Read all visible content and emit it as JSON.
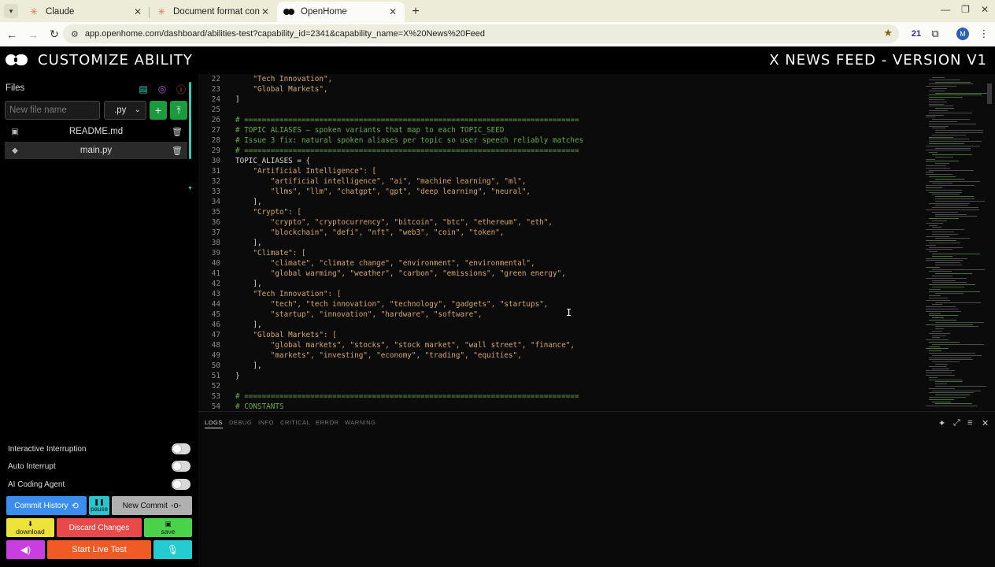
{
  "browser": {
    "tabs": [
      {
        "title": "Claude",
        "favicon": "claude-icon"
      },
      {
        "title": "Document format conve",
        "favicon": "claude-icon"
      },
      {
        "title": "OpenHome",
        "favicon": "openhome-icon"
      }
    ],
    "url": "app.openhome.com/dashboard/abilities-test?capability_id=2341&capability_name=X%20News%20Feed",
    "extension_badge": "21",
    "avatar_letter": "M"
  },
  "header": {
    "app_title": "CUSTOMIZE ABILITY",
    "ability_title": "X NEWS FEED - VERSION V1"
  },
  "sidebar": {
    "files_label": "Files",
    "filename_placeholder": "New file name",
    "extension_value": ".py",
    "files": [
      {
        "name": "README.md",
        "icon": "file-icon",
        "selected": false
      },
      {
        "name": "main.py",
        "icon": "python-icon",
        "selected": true
      }
    ],
    "toggles": [
      {
        "label": "Interactive Interruption",
        "on": false
      },
      {
        "label": "Auto Interrupt",
        "on": false
      },
      {
        "label": "AI Coding Agent",
        "on": false
      }
    ],
    "buttons": {
      "commit_history": "Commit History",
      "pause": "pause",
      "new_commit": "New Commit",
      "download": "download",
      "discard": "Discard Changes",
      "save": "save",
      "live_test": "Start Live Test"
    }
  },
  "editor": {
    "lines": [
      {
        "n": "22",
        "text": "    \"Tech Innovation\",",
        "kind": "str"
      },
      {
        "n": "23",
        "text": "    \"Global Markets\",",
        "kind": "str"
      },
      {
        "n": "24",
        "text": "]",
        "kind": "code"
      },
      {
        "n": "25",
        "text": "",
        "kind": "code"
      },
      {
        "n": "26",
        "text": "# ============================================================================",
        "kind": "comment"
      },
      {
        "n": "27",
        "text": "# TOPIC ALIASES — spoken variants that map to each TOPIC_SEED",
        "kind": "comment"
      },
      {
        "n": "28",
        "text": "# Issue 3 fix: natural spoken aliases per topic so user speech reliably matches",
        "kind": "comment"
      },
      {
        "n": "29",
        "text": "# ============================================================================",
        "kind": "comment"
      },
      {
        "n": "30",
        "text": "TOPIC_ALIASES = {",
        "kind": "code"
      },
      {
        "n": "31",
        "text": "    \"Artificial Intelligence\": [",
        "kind": "str"
      },
      {
        "n": "32",
        "text": "        \"artificial intelligence\", \"ai\", \"machine learning\", \"ml\",",
        "kind": "str"
      },
      {
        "n": "33",
        "text": "        \"llms\", \"llm\", \"chatgpt\", \"gpt\", \"deep learning\", \"neural\",",
        "kind": "str"
      },
      {
        "n": "34",
        "text": "    ],",
        "kind": "code"
      },
      {
        "n": "35",
        "text": "    \"Crypto\": [",
        "kind": "str"
      },
      {
        "n": "36",
        "text": "        \"crypto\", \"cryptocurrency\", \"bitcoin\", \"btc\", \"ethereum\", \"eth\",",
        "kind": "str"
      },
      {
        "n": "37",
        "text": "        \"blockchain\", \"defi\", \"nft\", \"web3\", \"coin\", \"token\",",
        "kind": "str"
      },
      {
        "n": "38",
        "text": "    ],",
        "kind": "code"
      },
      {
        "n": "39",
        "text": "    \"Climate\": [",
        "kind": "str"
      },
      {
        "n": "40",
        "text": "        \"climate\", \"climate change\", \"environment\", \"environmental\",",
        "kind": "str"
      },
      {
        "n": "41",
        "text": "        \"global warming\", \"weather\", \"carbon\", \"emissions\", \"green energy\",",
        "kind": "str"
      },
      {
        "n": "42",
        "text": "    ],",
        "kind": "code"
      },
      {
        "n": "43",
        "text": "    \"Tech Innovation\": [",
        "kind": "str"
      },
      {
        "n": "44",
        "text": "        \"tech\", \"tech innovation\", \"technology\", \"gadgets\", \"startups\",",
        "kind": "str"
      },
      {
        "n": "45",
        "text": "        \"startup\", \"innovation\", \"hardware\", \"software\",",
        "kind": "str"
      },
      {
        "n": "46",
        "text": "    ],",
        "kind": "code"
      },
      {
        "n": "47",
        "text": "    \"Global Markets\": [",
        "kind": "str"
      },
      {
        "n": "48",
        "text": "        \"global markets\", \"stocks\", \"stock market\", \"wall street\", \"finance\",",
        "kind": "str"
      },
      {
        "n": "49",
        "text": "        \"markets\", \"investing\", \"economy\", \"trading\", \"equities\",",
        "kind": "str"
      },
      {
        "n": "50",
        "text": "    ],",
        "kind": "code"
      },
      {
        "n": "51",
        "text": "}",
        "kind": "code"
      },
      {
        "n": "52",
        "text": "",
        "kind": "code"
      },
      {
        "n": "53",
        "text": "# ============================================================================",
        "kind": "comment"
      },
      {
        "n": "54",
        "text": "# CONSTANTS",
        "kind": "comment"
      }
    ]
  },
  "logs": {
    "tabs": [
      "LOGS",
      "DEBUG",
      "INFO",
      "CRITICAL",
      "ERROR",
      "WARNING"
    ],
    "active_tab": "LOGS"
  },
  "colors": {
    "accent_teal": "#37c8b0",
    "commit_blue": "#3b8ef0",
    "discard_red": "#e84a4a",
    "save_green": "#49d24a",
    "live_test_orange": "#f05a24"
  }
}
